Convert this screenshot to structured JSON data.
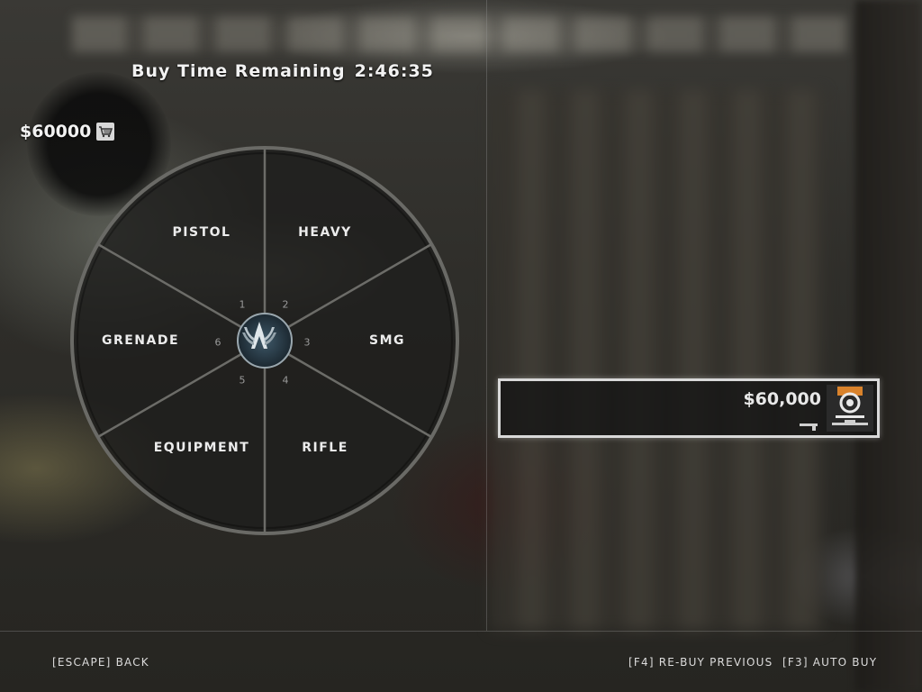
{
  "header": {
    "buy_time_label": "Buy Time Remaining",
    "buy_time_value": "2:46:35"
  },
  "money": {
    "amount": "$60000",
    "icon": "shopping-cart-icon"
  },
  "wheel": {
    "center_icon": "counter-terrorist-emblem-icon",
    "categories": [
      {
        "key": "1",
        "label": "PISTOL"
      },
      {
        "key": "2",
        "label": "HEAVY"
      },
      {
        "key": "3",
        "label": "SMG"
      },
      {
        "key": "4",
        "label": "RIFLE"
      },
      {
        "key": "5",
        "label": "EQUIPMENT"
      },
      {
        "key": "6",
        "label": "GRENADE"
      }
    ]
  },
  "loadout": {
    "price": "$60,000",
    "icons": [
      "pistol-icon",
      "sniper-rifle-icon",
      "world-aim-medal-icon"
    ],
    "medal_accent": "#d9822b"
  },
  "footer": {
    "back": "[ESCAPE] BACK",
    "rebuy": "[F4] RE-BUY PREVIOUS",
    "autobuy": "[F3] AUTO BUY"
  }
}
